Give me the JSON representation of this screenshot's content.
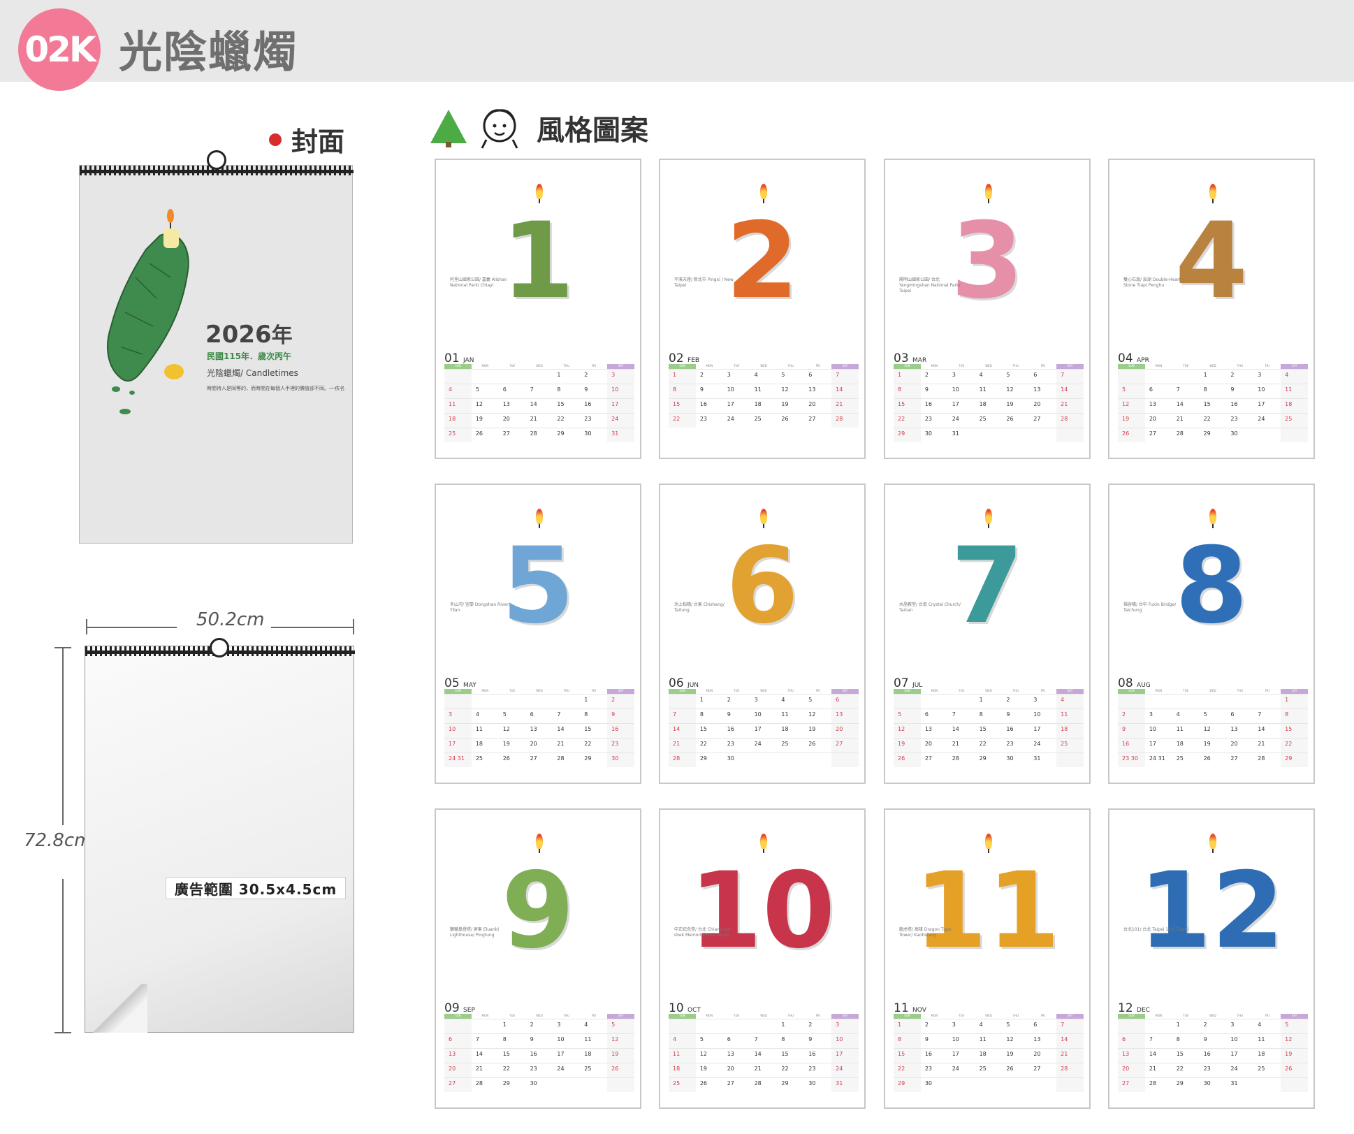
{
  "header": {
    "code": "02K",
    "title": "光陰蠟燭"
  },
  "cover": {
    "heading": "封面",
    "year": "2026",
    "year_suffix": "年",
    "roc": "民國115年．歲次丙午",
    "name": "光陰蠟燭/ Candletimes",
    "quote": "時間待人是同等的，而時間在每個人手裡的價值卻不同。──佚名"
  },
  "dimensions": {
    "width": "50.2cm",
    "height": "72.8cm",
    "ad_area": "廣告範圍 30.5x4.5cm"
  },
  "style_section": {
    "heading": "風格圖案"
  },
  "weekday_headers": [
    "SUN",
    "MON",
    "TUE",
    "WED",
    "THU",
    "FRI",
    "SAT"
  ],
  "colors": {
    "badge": "#f27a97",
    "header_band": "#e8e8e8",
    "sunday_bar": "#9ccc8a",
    "saturday_bar": "#c6a8d8",
    "weekend_text": "#d43a4d"
  },
  "months": [
    {
      "num": "01",
      "abbr": "JAN",
      "digit": "1",
      "color": "#6f9a48",
      "caption": "阿里山國家公園/ 嘉義 Alishan National Park/ Chiayi",
      "weeks": [
        [
          "",
          "",
          "",
          "",
          "1",
          "2",
          "3"
        ],
        [
          "4",
          "5",
          "6",
          "7",
          "8",
          "9",
          "10"
        ],
        [
          "11",
          "12",
          "13",
          "14",
          "15",
          "16",
          "17"
        ],
        [
          "18",
          "19",
          "20",
          "21",
          "22",
          "23",
          "24"
        ],
        [
          "25",
          "26",
          "27",
          "28",
          "29",
          "30",
          "31"
        ]
      ]
    },
    {
      "num": "02",
      "abbr": "FEB",
      "digit": "2",
      "color": "#e06a2a",
      "caption": "平溪天燈/ 新北市 Pingxi / New Taipei",
      "weeks": [
        [
          "1",
          "2",
          "3",
          "4",
          "5",
          "6",
          "7"
        ],
        [
          "8",
          "9",
          "10",
          "11",
          "12",
          "13",
          "14"
        ],
        [
          "15",
          "16",
          "17",
          "18",
          "19",
          "20",
          "21"
        ],
        [
          "22",
          "23",
          "24",
          "25",
          "26",
          "27",
          "28"
        ]
      ]
    },
    {
      "num": "03",
      "abbr": "MAR",
      "digit": "3",
      "color": "#e58fa8",
      "caption": "陽明山國家公園/ 台北 Yangmingshan National Park/ Taipei",
      "weeks": [
        [
          "1",
          "2",
          "3",
          "4",
          "5",
          "6",
          "7"
        ],
        [
          "8",
          "9",
          "10",
          "11",
          "12",
          "13",
          "14"
        ],
        [
          "15",
          "16",
          "17",
          "18",
          "19",
          "20",
          "21"
        ],
        [
          "22",
          "23",
          "24",
          "25",
          "26",
          "27",
          "28"
        ],
        [
          "29",
          "30",
          "31",
          "",
          "",
          "",
          ""
        ]
      ]
    },
    {
      "num": "04",
      "abbr": "APR",
      "digit": "4",
      "color": "#b9823f",
      "caption": "雙心石滬/ 澎湖 Double-Heart Stone Trap/ Penghu",
      "weeks": [
        [
          "",
          "",
          "",
          "1",
          "2",
          "3",
          "4"
        ],
        [
          "5",
          "6",
          "7",
          "8",
          "9",
          "10",
          "11"
        ],
        [
          "12",
          "13",
          "14",
          "15",
          "16",
          "17",
          "18"
        ],
        [
          "19",
          "20",
          "21",
          "22",
          "23",
          "24",
          "25"
        ],
        [
          "26",
          "27",
          "28",
          "29",
          "30",
          "",
          ""
        ]
      ]
    },
    {
      "num": "05",
      "abbr": "MAY",
      "digit": "5",
      "color": "#6fa6d6",
      "caption": "冬山河/ 宜蘭 Dongshan River/ Yilan",
      "weeks": [
        [
          "",
          "",
          "",
          "",
          "",
          "1",
          "2"
        ],
        [
          "3",
          "4",
          "5",
          "6",
          "7",
          "8",
          "9"
        ],
        [
          "10",
          "11",
          "12",
          "13",
          "14",
          "15",
          "16"
        ],
        [
          "17",
          "18",
          "19",
          "20",
          "21",
          "22",
          "23"
        ],
        [
          "24 31",
          "25",
          "26",
          "27",
          "28",
          "29",
          "30"
        ]
      ]
    },
    {
      "num": "06",
      "abbr": "JUN",
      "digit": "6",
      "color": "#e2a232",
      "caption": "池上稻穗/ 台東 Chishang/ Taitung",
      "weeks": [
        [
          "",
          "1",
          "2",
          "3",
          "4",
          "5",
          "6"
        ],
        [
          "7",
          "8",
          "9",
          "10",
          "11",
          "12",
          "13"
        ],
        [
          "14",
          "15",
          "16",
          "17",
          "18",
          "19",
          "20"
        ],
        [
          "21",
          "22",
          "23",
          "24",
          "25",
          "26",
          "27"
        ],
        [
          "28",
          "29",
          "30",
          "",
          "",
          "",
          ""
        ]
      ]
    },
    {
      "num": "07",
      "abbr": "JUL",
      "digit": "7",
      "color": "#3d9a9a",
      "caption": "水晶教堂/ 台南 Crystal Church/ Tainan",
      "weeks": [
        [
          "",
          "",
          "",
          "1",
          "2",
          "3",
          "4"
        ],
        [
          "5",
          "6",
          "7",
          "8",
          "9",
          "10",
          "11"
        ],
        [
          "12",
          "13",
          "14",
          "15",
          "16",
          "17",
          "18"
        ],
        [
          "19",
          "20",
          "21",
          "22",
          "23",
          "24",
          "25"
        ],
        [
          "26",
          "27",
          "28",
          "29",
          "30",
          "31",
          ""
        ]
      ]
    },
    {
      "num": "08",
      "abbr": "AUG",
      "digit": "8",
      "color": "#2f6fb8",
      "caption": "福容橋/ 台中 Fuxin Bridge/ Taichung",
      "weeks": [
        [
          "",
          "",
          "",
          "",
          "",
          "",
          "1"
        ],
        [
          "2",
          "3",
          "4",
          "5",
          "6",
          "7",
          "8"
        ],
        [
          "9",
          "10",
          "11",
          "12",
          "13",
          "14",
          "15"
        ],
        [
          "16",
          "17",
          "18",
          "19",
          "20",
          "21",
          "22"
        ],
        [
          "23 30",
          "24 31",
          "25",
          "26",
          "27",
          "28",
          "29"
        ]
      ]
    },
    {
      "num": "09",
      "abbr": "SEP",
      "digit": "9",
      "color": "#7fae55",
      "caption": "鵝鑾鼻燈塔/ 屏東 Eluanbi Lighthouse/ Pingtung",
      "weeks": [
        [
          "",
          "",
          "1",
          "2",
          "3",
          "4",
          "5"
        ],
        [
          "6",
          "7",
          "8",
          "9",
          "10",
          "11",
          "12"
        ],
        [
          "13",
          "14",
          "15",
          "16",
          "17",
          "18",
          "19"
        ],
        [
          "20",
          "21",
          "22",
          "23",
          "24",
          "25",
          "26"
        ],
        [
          "27",
          "28",
          "29",
          "30",
          "",
          "",
          ""
        ]
      ]
    },
    {
      "num": "10",
      "abbr": "OCT",
      "digit": "10",
      "color": "#c8344a",
      "caption": "中正紀念堂/ 台北 Chiang Kai-shek Memorial Hall/ Taipei",
      "weeks": [
        [
          "",
          "",
          "",
          "",
          "1",
          "2",
          "3"
        ],
        [
          "4",
          "5",
          "6",
          "7",
          "8",
          "9",
          "10"
        ],
        [
          "11",
          "12",
          "13",
          "14",
          "15",
          "16",
          "17"
        ],
        [
          "18",
          "19",
          "20",
          "21",
          "22",
          "23",
          "24"
        ],
        [
          "25",
          "26",
          "27",
          "28",
          "29",
          "30",
          "31"
        ]
      ]
    },
    {
      "num": "11",
      "abbr": "NOV",
      "digit": "11",
      "color": "#e4a126",
      "caption": "龍虎塔/ 高雄 Dragon Tiger Tower/ Kaohsiung",
      "weeks": [
        [
          "1",
          "2",
          "3",
          "4",
          "5",
          "6",
          "7"
        ],
        [
          "8",
          "9",
          "10",
          "11",
          "12",
          "13",
          "14"
        ],
        [
          "15",
          "16",
          "17",
          "18",
          "19",
          "20",
          "21"
        ],
        [
          "22",
          "23",
          "24",
          "25",
          "26",
          "27",
          "28"
        ],
        [
          "29",
          "30",
          "",
          "",
          "",
          "",
          ""
        ]
      ]
    },
    {
      "num": "12",
      "abbr": "DEC",
      "digit": "12",
      "color": "#2e6db4",
      "caption": "台北101/ 台北 Taipei 101/ Taipei",
      "weeks": [
        [
          "",
          "",
          "1",
          "2",
          "3",
          "4",
          "5"
        ],
        [
          "6",
          "7",
          "8",
          "9",
          "10",
          "11",
          "12"
        ],
        [
          "13",
          "14",
          "15",
          "16",
          "17",
          "18",
          "19"
        ],
        [
          "20",
          "21",
          "22",
          "23",
          "24",
          "25",
          "26"
        ],
        [
          "27",
          "28",
          "29",
          "30",
          "31",
          "",
          ""
        ]
      ]
    }
  ]
}
